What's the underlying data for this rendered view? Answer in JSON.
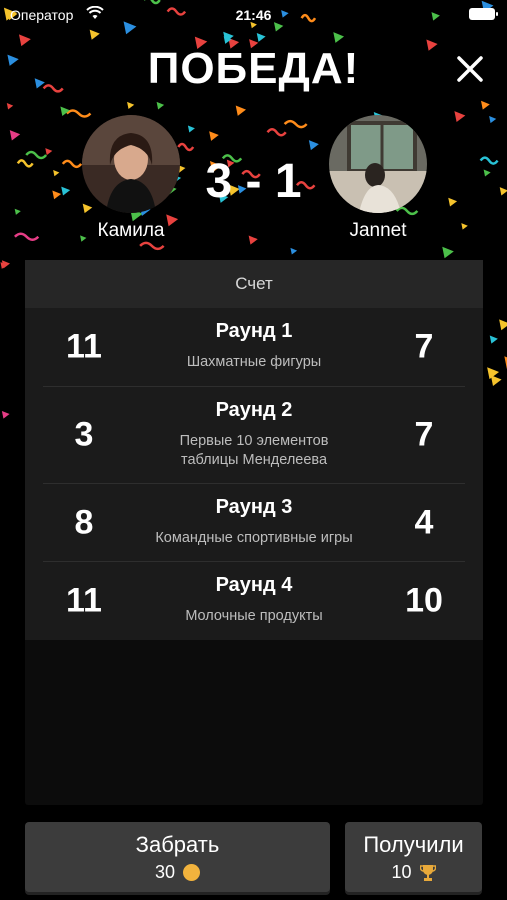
{
  "status_bar": {
    "carrier": "Оператор",
    "time": "21:46"
  },
  "header": {
    "title": "ПОБЕДА!"
  },
  "players": {
    "left": {
      "name": "Камила"
    },
    "right": {
      "name": "Jannet"
    },
    "score": "3 - 1"
  },
  "scoreboard": {
    "header": "Счет",
    "rounds": [
      {
        "name": "Раунд 1",
        "topic": "Шахматные фигуры",
        "left": "11",
        "right": "7"
      },
      {
        "name": "Раунд 2",
        "topic_line1": "Первые 10 элементов",
        "topic_line2": "таблицы Менделеева",
        "left": "3",
        "right": "7"
      },
      {
        "name": "Раунд 3",
        "topic": "Командные спортивные игры",
        "left": "8",
        "right": "4"
      },
      {
        "name": "Раунд 4",
        "topic": "Молочные продукты",
        "left": "11",
        "right": "10"
      }
    ]
  },
  "actions": {
    "take": {
      "label": "Забрать",
      "amount": "30"
    },
    "received": {
      "label": "Получили",
      "amount": "10"
    }
  },
  "colors": {
    "background": "#000000",
    "card": "#1b1b1b",
    "coin": "#f2b33d"
  }
}
